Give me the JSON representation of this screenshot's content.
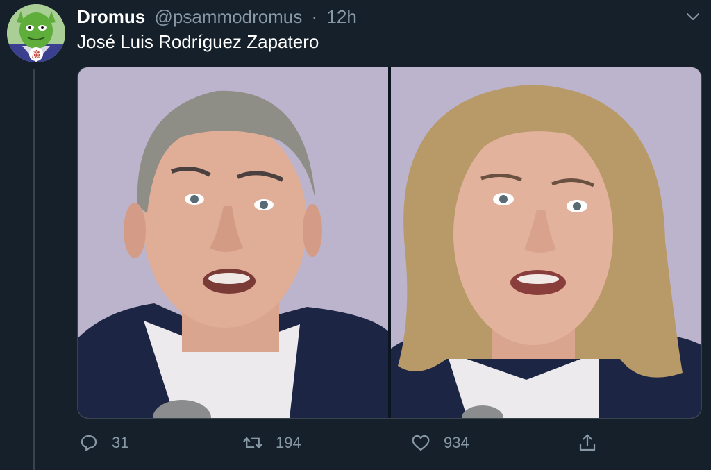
{
  "tweet": {
    "display_name": "Dromus",
    "handle": "@psammodromus",
    "separator": "·",
    "time": "12h",
    "text": "José Luis Rodríguez Zapatero",
    "avatar_glyph": "魔"
  },
  "actions": {
    "reply_count": "31",
    "retweet_count": "194",
    "like_count": "934"
  },
  "icons": {
    "caret": "chevron-down-icon",
    "reply": "reply-icon",
    "retweet": "retweet-icon",
    "like": "heart-icon",
    "share": "share-icon"
  },
  "colors": {
    "background": "#15202b",
    "secondary_text": "#8899a6",
    "divider": "#38444d"
  }
}
